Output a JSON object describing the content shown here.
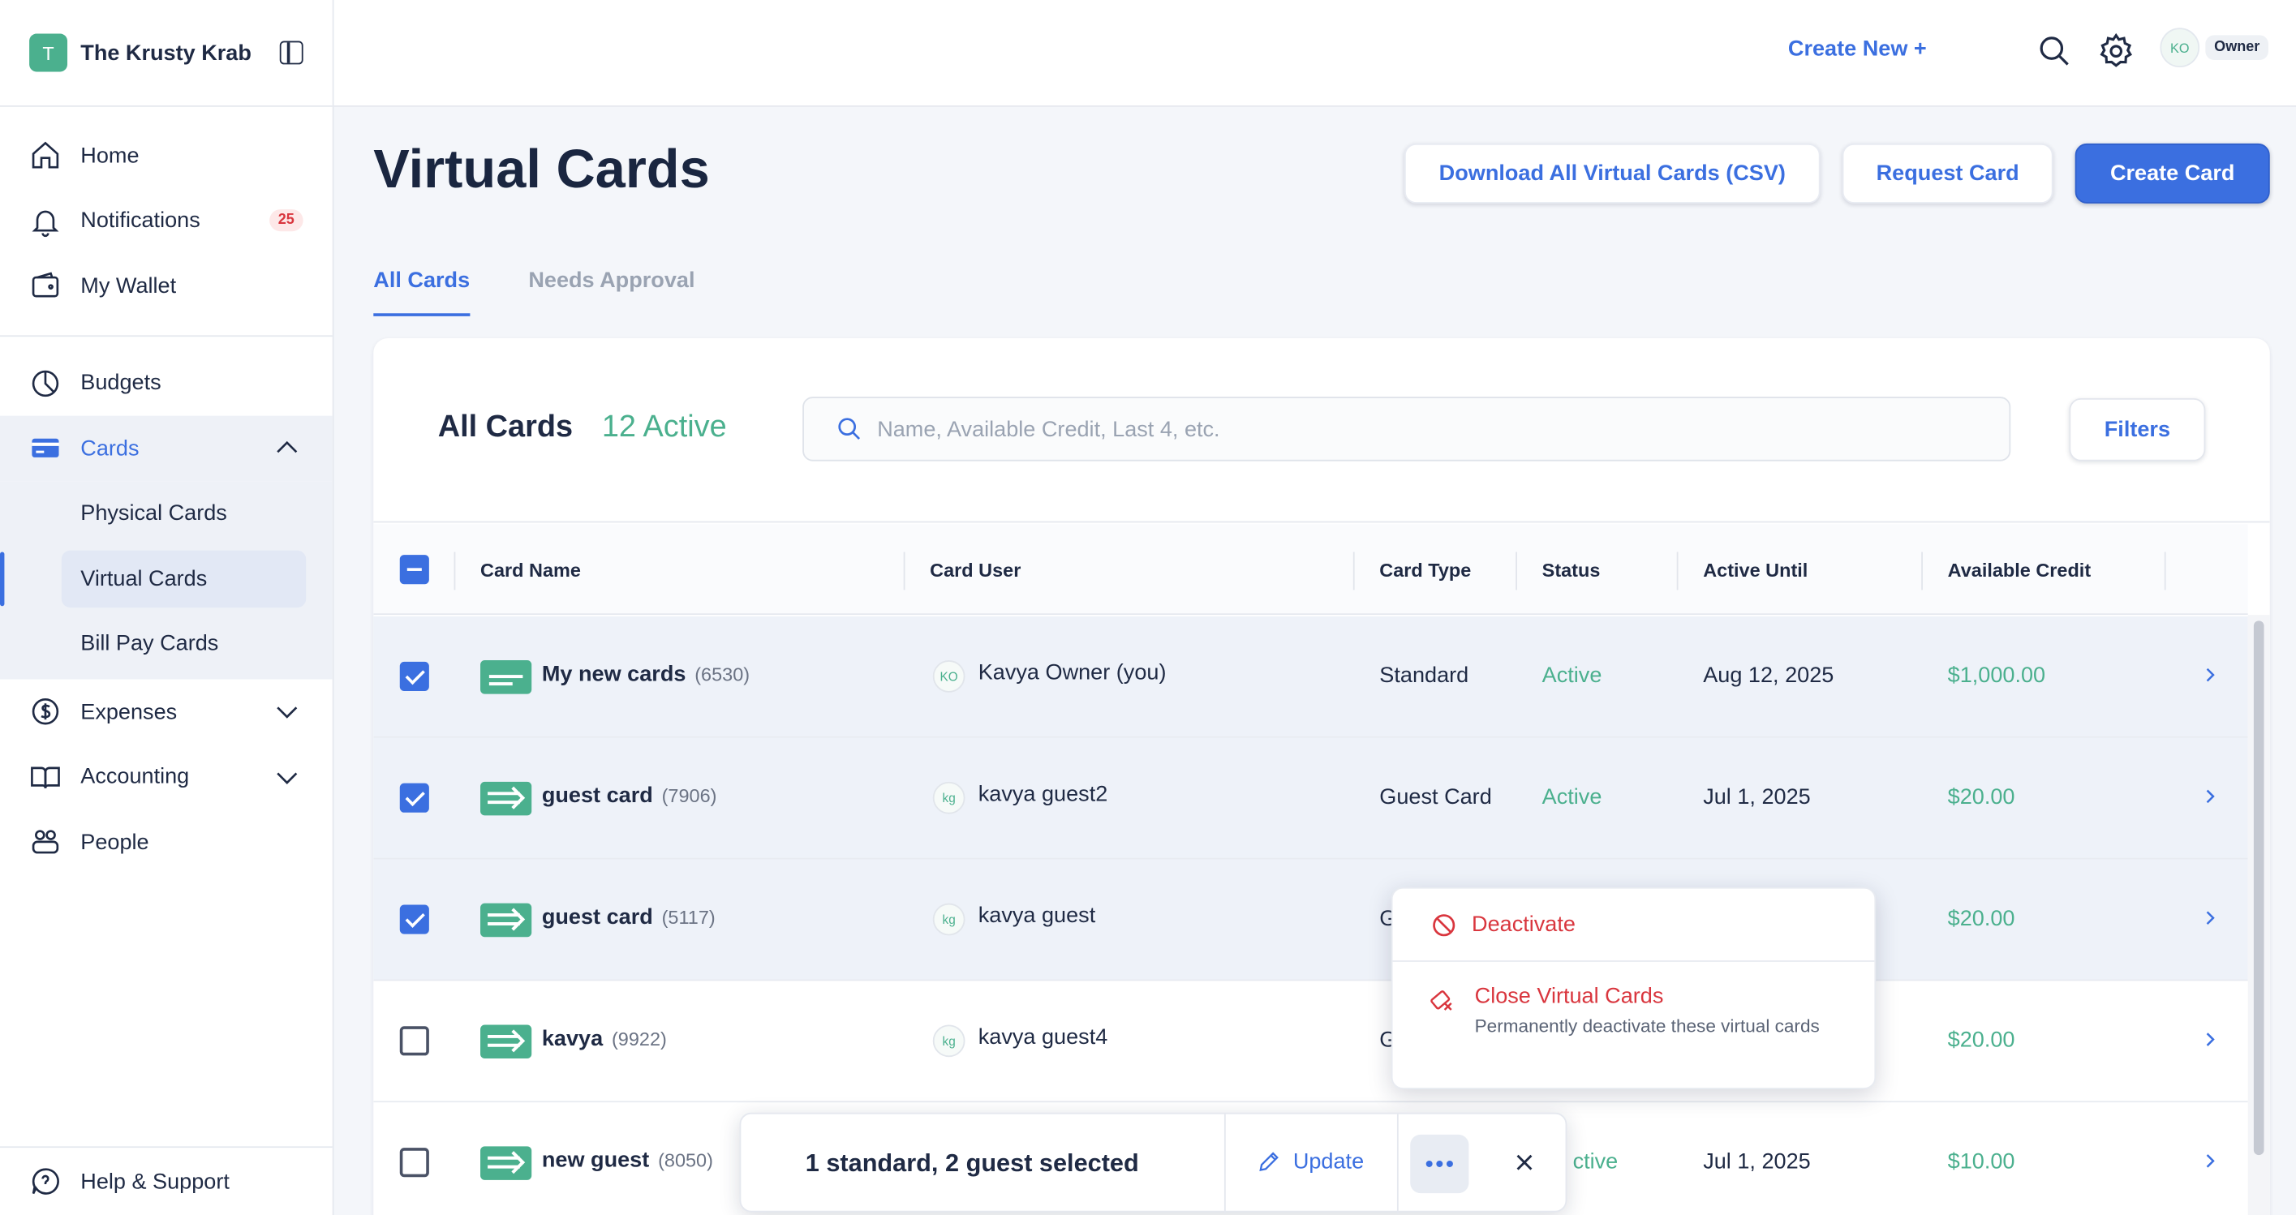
{
  "brand": {
    "initial": "T",
    "name": "The Krusty Krab"
  },
  "sidebar": {
    "primary": [
      {
        "label": "Home",
        "icon": "home-icon"
      },
      {
        "label": "Notifications",
        "icon": "bell-icon",
        "badge": "25"
      },
      {
        "label": "My Wallet",
        "icon": "wallet-icon"
      }
    ],
    "budgets": "Budgets",
    "cards": "Cards",
    "cards_sub": [
      "Physical Cards",
      "Virtual Cards",
      "Bill Pay Cards"
    ],
    "expenses": "Expenses",
    "accounting": "Accounting",
    "people": "People",
    "help": "Help & Support"
  },
  "topbar": {
    "create_new": "Create New +",
    "user_initials": "KO",
    "user_role": "Owner"
  },
  "header": {
    "title": "Virtual Cards",
    "download_btn": "Download All Virtual Cards (CSV)",
    "request_btn": "Request Card",
    "create_btn": "Create Card"
  },
  "tabs": [
    "All Cards",
    "Needs Approval"
  ],
  "panel": {
    "title": "All Cards",
    "active_count": "12 Active",
    "search_placeholder": "Name, Available Credit, Last 4, etc.",
    "filters_btn": "Filters"
  },
  "columns": [
    "Card Name",
    "Card User",
    "Card Type",
    "Status",
    "Active Until",
    "Available Credit"
  ],
  "rows": [
    {
      "name": "My new cards",
      "last4": "(6530)",
      "user_initials": "KO",
      "user": "Kavya Owner (you)",
      "type": "Standard",
      "status": "Active",
      "until": "Aug 12, 2025",
      "credit": "$1,000.00",
      "checked": true
    },
    {
      "name": "guest card",
      "last4": "(7906)",
      "user_initials": "kg",
      "user": "kavya guest2",
      "type": "Guest Card",
      "status": "Active",
      "until": "Jul 1, 2025",
      "credit": "$20.00",
      "checked": true
    },
    {
      "name": "guest card",
      "last4": "(5117)",
      "user_initials": "kg",
      "user": "kavya guest",
      "type": "G",
      "status": "",
      "until": "",
      "credit": "$20.00",
      "checked": true
    },
    {
      "name": "kavya",
      "last4": "(9922)",
      "user_initials": "kg",
      "user": "kavya guest4",
      "type": "G",
      "status": "",
      "until": "",
      "credit": "$20.00",
      "checked": false
    },
    {
      "name": "new guest",
      "last4": "(8050)",
      "user_initials": "",
      "user": "",
      "type": "",
      "status": "ctive",
      "until": "Jul 1, 2025",
      "credit": "$10.00",
      "checked": false
    }
  ],
  "menu": {
    "deactivate": "Deactivate",
    "close_title": "Close Virtual Cards",
    "close_sub": "Permanently deactivate these virtual cards"
  },
  "selection_bar": {
    "summary": "1 standard, 2 guest selected",
    "update": "Update"
  },
  "colors": {
    "accent": "#3b6fe0",
    "success": "#4bb08e",
    "danger": "#d9363e"
  }
}
